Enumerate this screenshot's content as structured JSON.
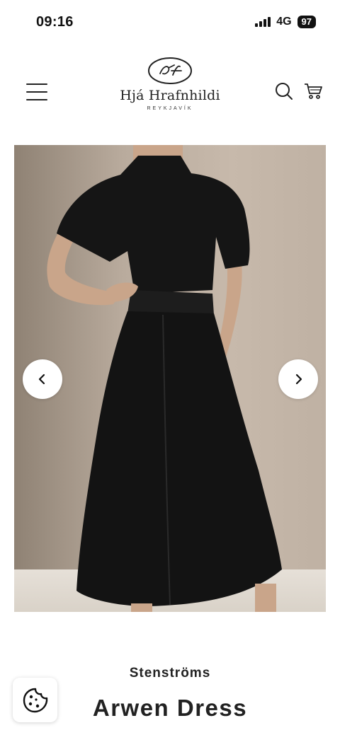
{
  "status_bar": {
    "time": "09:16",
    "network": "4G",
    "battery": "97"
  },
  "header": {
    "logo_name": "Hjá Hrafnhildi",
    "logo_sub": "REYKJAVÍK",
    "icons": [
      "menu-icon",
      "search-icon",
      "cart-icon"
    ]
  },
  "product": {
    "brand": "Stenströms",
    "title": "Arwen Dress",
    "image_alt": "model wearing black dress",
    "carousel": {
      "prev_icon": "chevron-left-icon",
      "next_icon": "chevron-right-icon"
    }
  },
  "cookie": {
    "icon": "cookie-icon"
  },
  "colors": {
    "accent": "#222222",
    "background": "#ffffff",
    "photo_wall": "#b7a89a",
    "dress": "#141414"
  }
}
